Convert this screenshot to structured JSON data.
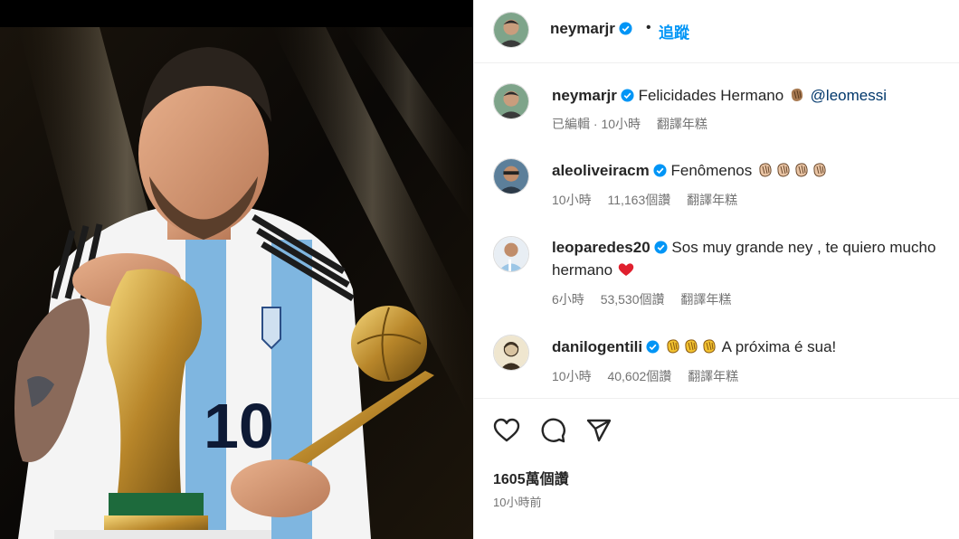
{
  "post": {
    "author": "neymarjr",
    "follow_label": "追蹤",
    "dot": "•",
    "likes": "1605萬個讚",
    "time": "10小時前"
  },
  "caption": {
    "user": "neymarjr",
    "text": "Felicidades Hermano",
    "mention": "@leomessi",
    "meta": [
      "已編輯 · 10小時",
      "翻譯年糕"
    ]
  },
  "comments": [
    {
      "user": "aleoliveiracm",
      "text": "Fenômenos",
      "line2": "",
      "time": "10小時",
      "likes": "11,163個讚",
      "translate": "翻譯年糕"
    },
    {
      "user": "leoparedes20",
      "text": "Sos muy grande ney , te quiero mucho",
      "line2": "hermano",
      "time": "6小時",
      "likes": "53,530個讚",
      "translate": "翻譯年糕"
    },
    {
      "user": "danilogentili",
      "text": "A próxima é sua!",
      "line2": "",
      "time": "10小時",
      "likes": "40,602個讚",
      "translate": "翻譯年糕"
    }
  ],
  "icons": [
    "verified-badge-icon",
    "heart-icon",
    "comment-icon",
    "share-icon",
    "clap-emoji-icon",
    "red-heart-emoji-icon"
  ],
  "colors": {
    "link": "#0095f6",
    "verified": "#0095f6",
    "mention": "#00376b",
    "meta": "#737373"
  }
}
